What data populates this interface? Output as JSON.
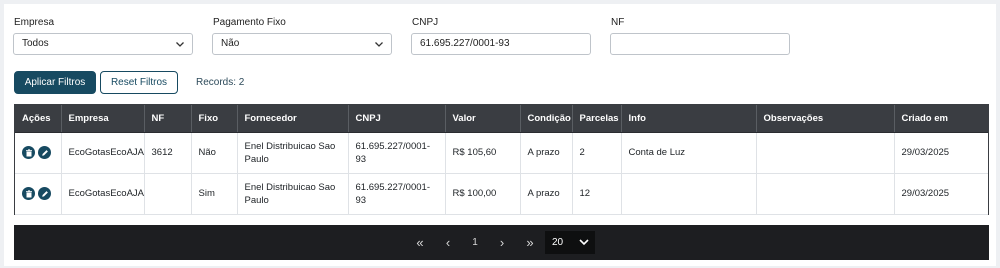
{
  "filters": {
    "empresa": {
      "label": "Empresa",
      "value": "Todos"
    },
    "pagamento_fixo": {
      "label": "Pagamento Fixo",
      "value": "Não"
    },
    "cnpj": {
      "label": "CNPJ",
      "value": "61.695.227/0001-93"
    },
    "nf": {
      "label": "NF",
      "value": ""
    }
  },
  "actions": {
    "apply_label": "Aplicar Filtros",
    "reset_label": "Reset Filtros",
    "records_text": "Records: 2"
  },
  "table": {
    "headers": [
      "Ações",
      "Empresa",
      "NF",
      "Fixo",
      "Fornecedor",
      "CNPJ",
      "Valor",
      "Condição",
      "Parcelas",
      "Info",
      "Observações",
      "Criado em"
    ],
    "rows": [
      {
        "empresa": "EcoGotasEcoAJA",
        "nf": "3612",
        "fixo": "Não",
        "fornecedor": "Enel Distribuicao Sao Paulo",
        "cnpj": "61.695.227/0001-93",
        "valor": "R$ 105,60",
        "condicao": "A prazo",
        "parcelas": "2",
        "info": "Conta de Luz",
        "observacoes": "",
        "criado_em": "29/03/2025"
      },
      {
        "empresa": "EcoGotasEcoAJA",
        "nf": "",
        "fixo": "Sim",
        "fornecedor": "Enel Distribuicao Sao Paulo",
        "cnpj": "61.695.227/0001-93",
        "valor": "R$ 100,00",
        "condicao": "A prazo",
        "parcelas": "12",
        "info": "",
        "observacoes": "",
        "criado_em": "29/03/2025"
      }
    ]
  },
  "pagination": {
    "first": "«",
    "prev": "‹",
    "current_page": "1",
    "next": "›",
    "last": "»",
    "page_size": "20"
  },
  "icons": {
    "delete": "trash-icon",
    "edit": "pencil-icon",
    "dropdown": "chevron-down-icon"
  },
  "colors": {
    "primary": "#174a61",
    "table_header": "#3a3d42",
    "pager_bg": "#1d1e21"
  }
}
